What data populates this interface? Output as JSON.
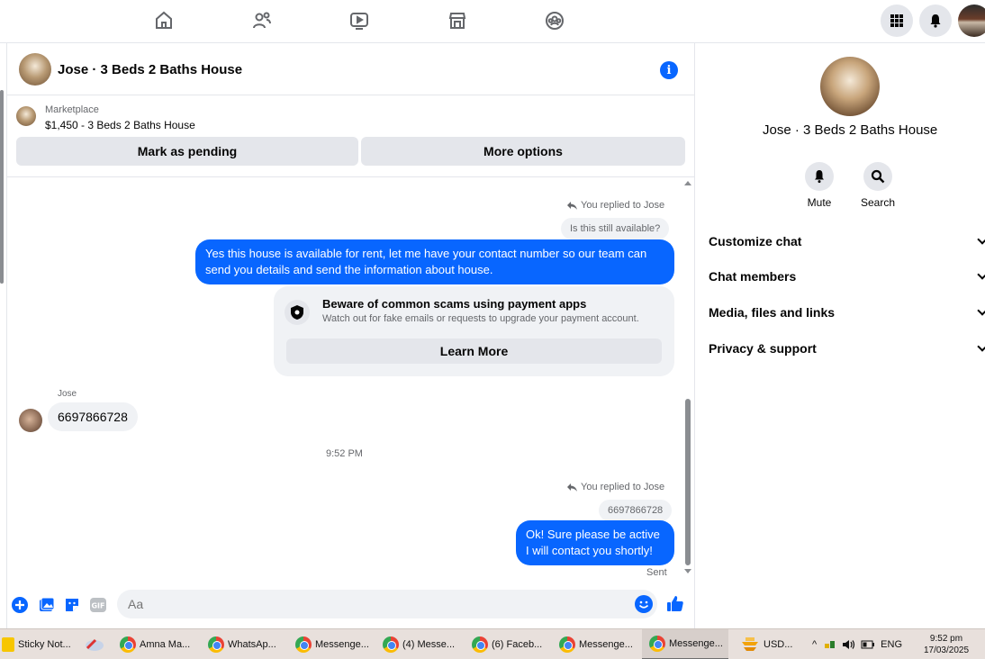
{
  "topnav": {
    "icons": [
      "home-icon",
      "friends-icon",
      "video-icon",
      "marketplace-icon",
      "groups-icon"
    ],
    "right_icons": [
      "menu-grid-icon",
      "notifications-bell-icon",
      "profile-avatar"
    ]
  },
  "chat": {
    "title": "Jose · 3 Beds 2 Baths House",
    "marketplace": {
      "label": "Marketplace",
      "price_title": "$1,450 - 3 Beds 2 Baths House",
      "buttons": {
        "mark_pending": "Mark as pending",
        "more_options": "More options"
      }
    },
    "messages": {
      "reply_note_1": "You replied to Jose",
      "quoted_1": "Is this still available?",
      "outgoing_1": "Yes this house is  available for rent, let me have your contact number so our team can send you details and send the information about house.",
      "scam_card": {
        "title": "Beware of common scams using payment apps",
        "subtitle": "Watch out for fake emails or requests to upgrade your payment account.",
        "button": "Learn More"
      },
      "sender_name": "Jose",
      "incoming_1": "6697866728",
      "timestamp": "9:52 PM",
      "reply_note_2": "You replied to Jose",
      "quoted_2": "6697866728",
      "outgoing_2_line1": "Ok! Sure please be active",
      "outgoing_2_line2": "I will contact you shortly!",
      "status": "Sent"
    },
    "composer": {
      "placeholder": "Aa"
    }
  },
  "right_panel": {
    "title": "Jose · 3 Beds 2 Baths House",
    "actions": [
      {
        "label": "Mute",
        "icon": "bell-icon"
      },
      {
        "label": "Search",
        "icon": "search-icon"
      }
    ],
    "sections": [
      "Customize chat",
      "Chat members",
      "Media, files and links",
      "Privacy & support"
    ]
  },
  "taskbar": {
    "items": [
      "Sticky Not...",
      "Amna Ma...",
      "WhatsAp...",
      "Messenge...",
      "(4) Messe...",
      "(6) Faceb...",
      "Messenge...",
      "Messenge..."
    ],
    "weather": "USD...",
    "language": "ENG",
    "time": "9:52 pm",
    "date": "17/03/2025"
  },
  "colors": {
    "accent": "#0866ff",
    "bubble_in": "#f0f2f5",
    "button_gray": "#e4e6eb"
  }
}
